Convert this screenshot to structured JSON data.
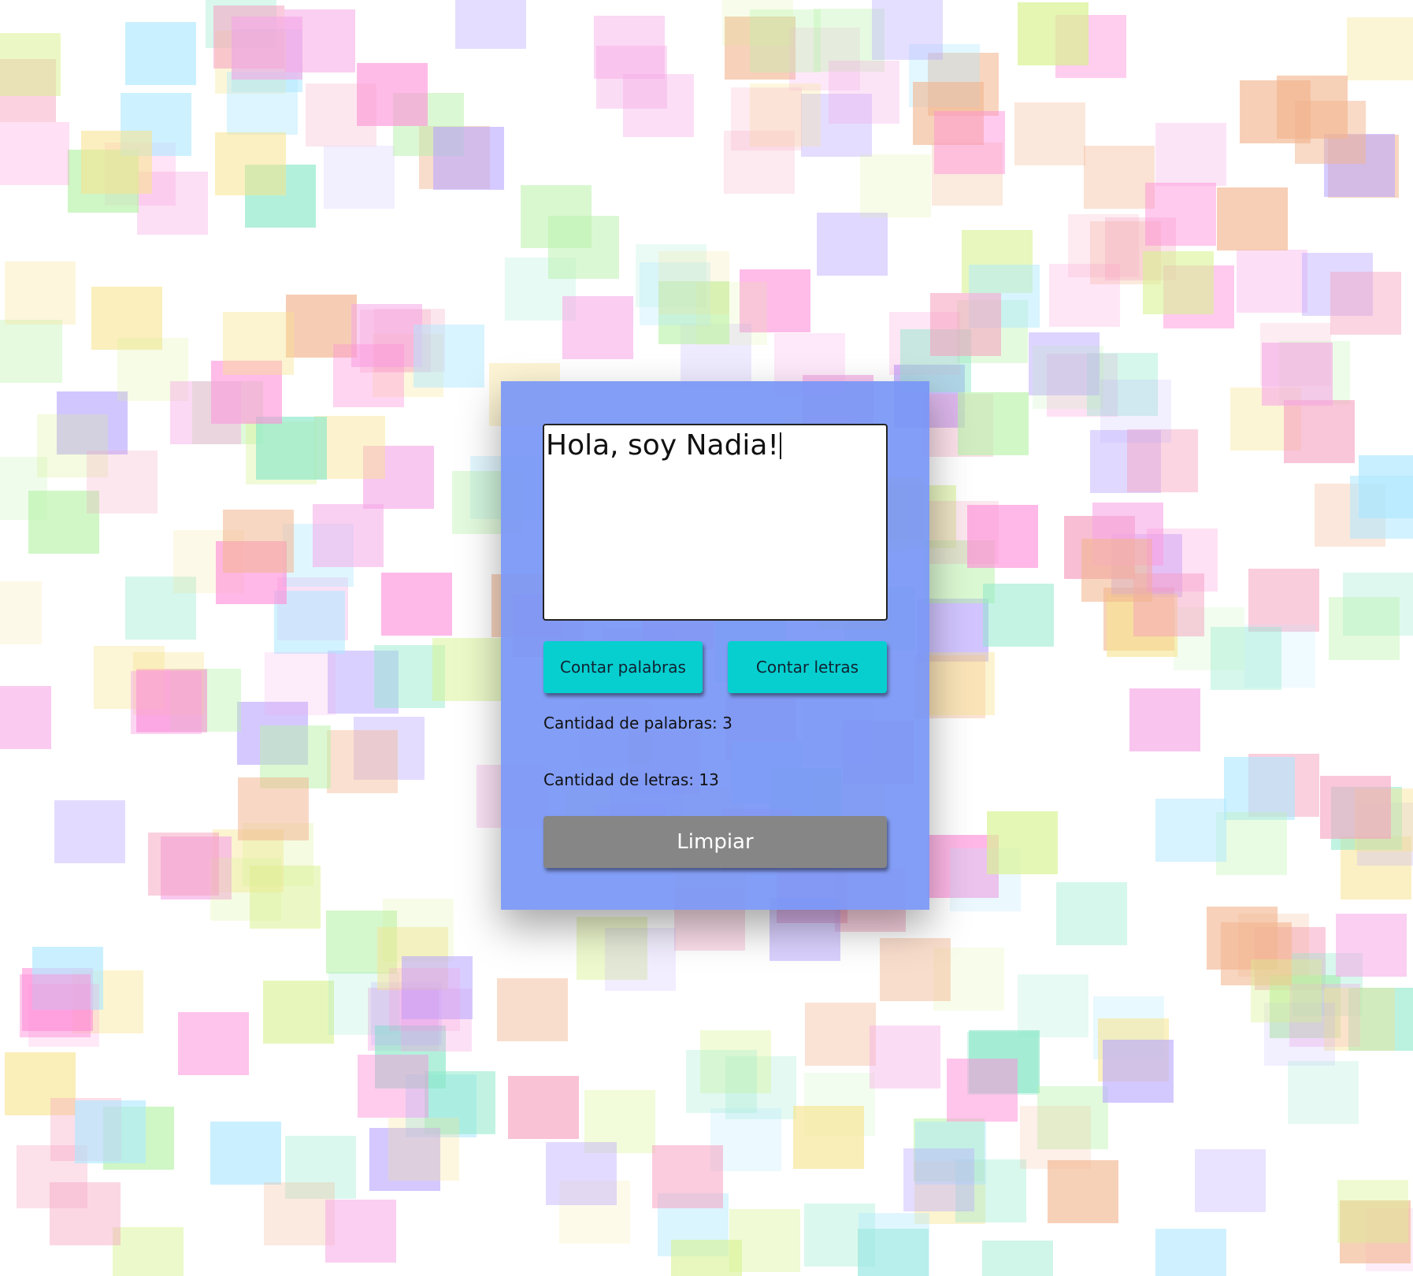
{
  "colors": {
    "card_background": "#7896f5",
    "count_button": "#07cfcf",
    "clear_button": "#868686",
    "textarea_background": "#ffffff",
    "background_palette": [
      "#f59fbe",
      "#ff8bd8",
      "#aee8ff",
      "#b8f2a9",
      "#f7e38d",
      "#f2b58f",
      "#b8a5ff",
      "#8ce8c9",
      "#d7f28e",
      "#f6a7e6"
    ]
  },
  "editor": {
    "text": "Hola, soy Nadia!"
  },
  "buttons": {
    "count_words": "Contar palabras",
    "count_letters": "Contar letras",
    "clear": "Limpiar"
  },
  "results": {
    "words": "Cantidad de palabras: 3",
    "letters": "Cantidad de letras: 13"
  }
}
